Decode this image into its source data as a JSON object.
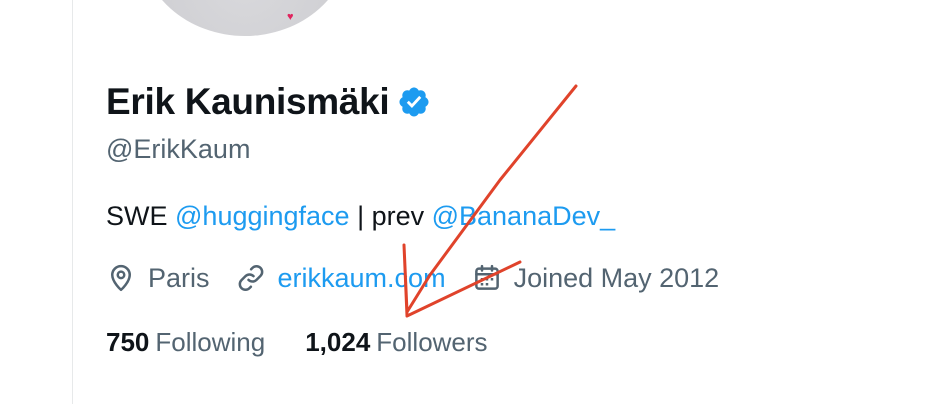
{
  "profile": {
    "display_name": "Erik Kaunismäki",
    "handle": "@ErikKaum",
    "verified": true,
    "bio": {
      "prefix": "SWE ",
      "mention1": "@huggingface",
      "middle": " | prev ",
      "mention2": "@BananaDev_"
    },
    "location": "Paris",
    "website": "erikkaum.com",
    "joined": "Joined May 2012",
    "stats": {
      "following_count": "750",
      "following_label": "Following",
      "followers_count": "1,024",
      "followers_label": "Followers"
    }
  },
  "icons": {
    "verified": "verified-badge-icon",
    "location": "location-pin-icon",
    "website": "link-icon",
    "joined": "calendar-icon",
    "avatar_detail": "heart-icon"
  },
  "colors": {
    "text_primary": "#0f1419",
    "text_secondary": "#536471",
    "link": "#1d9bf0",
    "annotation": "#e0432b"
  }
}
